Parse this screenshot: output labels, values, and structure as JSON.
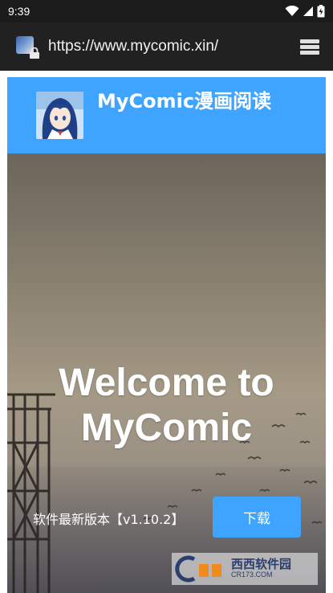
{
  "status_bar": {
    "time": "9:39",
    "icons": [
      "wifi-icon",
      "signal-icon",
      "battery-charging-icon"
    ]
  },
  "browser": {
    "url": "https://www.mycomic.xin/",
    "icons": [
      "site-favicon",
      "lock-icon",
      "tabs-menu-icon"
    ]
  },
  "header": {
    "title": "MyComic漫画阅读"
  },
  "hero": {
    "title_line1": "Welcome to",
    "title_line2": "MyComic",
    "version_text": "软件最新版本【v1.10.2】",
    "download_label": "下载"
  },
  "watermark": {
    "brand": "西西软件园",
    "domain": "CR173.COM"
  },
  "colors": {
    "accent": "#3fa4ff",
    "status_bar": "#1b1b1b",
    "url_bar": "#212121"
  }
}
